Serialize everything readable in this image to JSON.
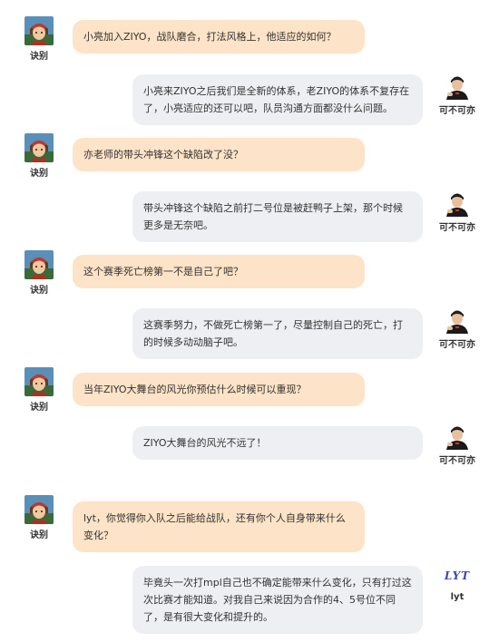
{
  "users": {
    "interviewer": "诀别",
    "player1": "可不可亦",
    "player2": "lyt",
    "player2_logo": "LYT"
  },
  "messages": [
    {
      "from": "interviewer",
      "text": "小亮加入ZIYO，战队磨合，打法风格上，他适应的如何？"
    },
    {
      "from": "player1",
      "text": "小亮来ZIYO之后我们是全新的体系，老ZIYO的体系不复存在了，小亮适应的还可以吧，队员沟通方面都没什么问题。"
    },
    {
      "from": "interviewer",
      "text": "亦老师的带头冲锋这个缺陷改了没？"
    },
    {
      "from": "player1",
      "text": "带头冲锋这个缺陷之前打二号位是被赶鸭子上架，那个时候更多是无奈吧。"
    },
    {
      "from": "interviewer",
      "text": "这个赛季死亡榜第一不是自己了吧？"
    },
    {
      "from": "player1",
      "text": "这赛季努力，不做死亡榜第一了，尽量控制自己的死亡，打的时候多动动脑子吧。"
    },
    {
      "from": "interviewer",
      "text": "当年ZIYO大舞台的风光你预估什么时候可以重现？"
    },
    {
      "from": "player1",
      "text": "ZIYO大舞台的风光不远了！"
    },
    {
      "from": "interviewer",
      "text": "lyt，你觉得你入队之后能给战队，还有你个人自身带来什么变化？"
    },
    {
      "from": "player2",
      "text": "毕竟头一次打mpl自己也不确定能带来什么变化，只有打过这次比赛才能知道。对我自己来说因为合作的4、5号位不同了，是有很大变化和提升的。"
    }
  ],
  "colors": {
    "question_bubble": "#fde3c7",
    "answer_bubble": "#edeff2",
    "text": "#333333"
  }
}
